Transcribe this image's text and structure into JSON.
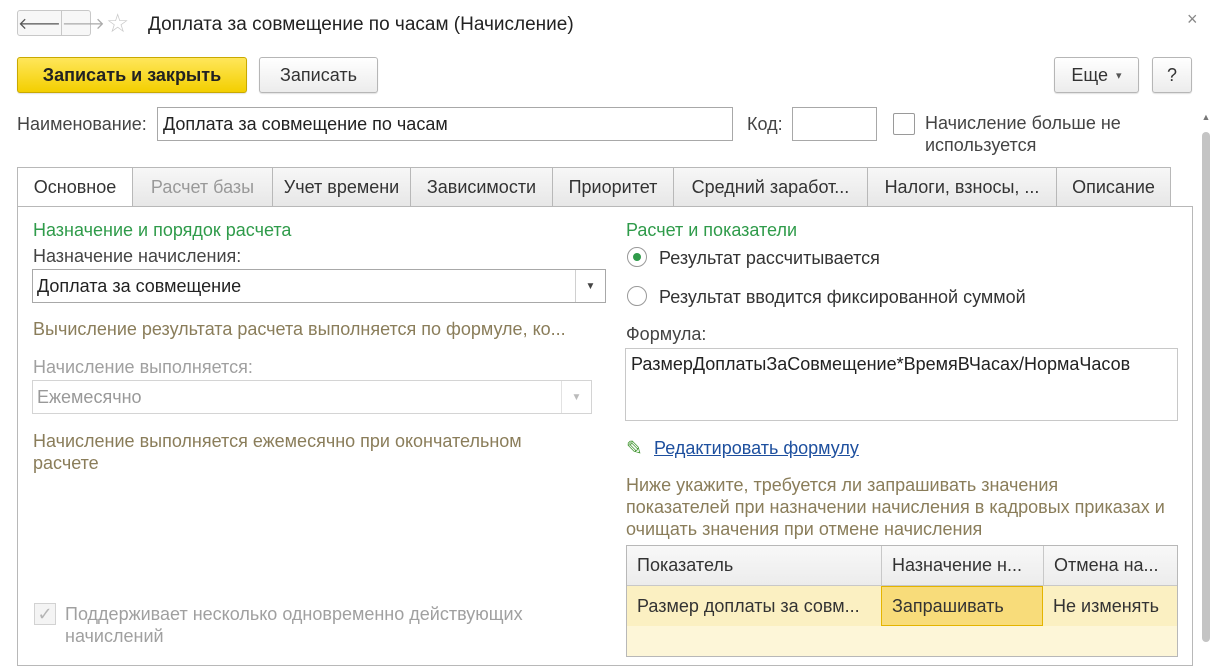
{
  "window": {
    "title": "Доплата за совмещение по часам (Начисление)",
    "back_icon": "arrow-left-icon",
    "forward_icon": "arrow-right-icon",
    "back_glyph": "🡐",
    "forward_glyph": "🡒",
    "star_glyph": "☆",
    "close_glyph": "×"
  },
  "toolbar": {
    "save_close_label": "Записать и закрыть",
    "save_label": "Записать",
    "more_label": "Еще",
    "more_arrow": "▾",
    "help_label": "?"
  },
  "header": {
    "name_label": "Наименование:",
    "name_value": "Доплата за совмещение по часам",
    "code_label": "Код:",
    "code_value": "",
    "not_used_label_1": "Начисление больше не",
    "not_used_label_2": "используется"
  },
  "tabs": [
    {
      "label": "Основное",
      "active": true
    },
    {
      "label": "Расчет базы",
      "disabled": true
    },
    {
      "label": "Учет времени"
    },
    {
      "label": "Зависимости"
    },
    {
      "label": "Приоритет"
    },
    {
      "label": "Средний заработ..."
    },
    {
      "label": "Налоги, взносы, ..."
    },
    {
      "label": "Описание"
    }
  ],
  "left": {
    "section_title": "Назначение и порядок расчета",
    "purpose_label": "Назначение начисления:",
    "purpose_value": "Доплата за совмещение",
    "formula_note": "Вычисление результата расчета выполняется по формуле, ко...",
    "period_label": "Начисление выполняется:",
    "period_value": "Ежемесячно",
    "period_note_1": "Начисление выполняется ежемесячно при окончательном",
    "period_note_2": "расчете",
    "multi_label_1": "Поддерживает несколько одновременно действующих",
    "multi_label_2": "начислений",
    "check_glyph": "✓"
  },
  "right": {
    "section_title": "Расчет и показатели",
    "radio_calc": "Результат рассчитывается",
    "radio_fixed": "Результат вводится фиксированной суммой",
    "formula_label": "Формула:",
    "formula_value": "РазмерДоплатыЗаСовмещение*ВремяВЧасах/НормаЧасов",
    "edit_formula_link": "Редактировать формулу",
    "pencil_glyph": "✎",
    "hint_1": "Ниже укажите, требуется ли запрашивать значения",
    "hint_2": "показателей при назначении начисления в кадровых приказах и",
    "hint_3": "очищать значения при отмене начисления"
  },
  "table": {
    "columns": [
      "Показатель",
      "Назначение н...",
      "Отмена на..."
    ],
    "rows": [
      [
        "Размер доплаты за совм...",
        "Запрашивать",
        "Не изменять"
      ]
    ]
  },
  "dropdown_arrow": "▼"
}
